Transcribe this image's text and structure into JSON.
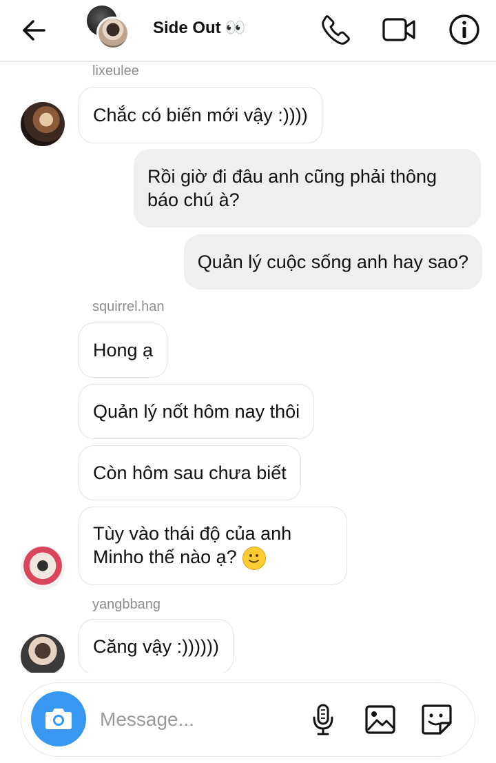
{
  "header": {
    "title": "Side Out",
    "title_emoji": "👀"
  },
  "messages": {
    "sender_1": "lixeulee",
    "m1": "Chắc có biến mới vậy :))))",
    "m2": "Rồi giờ đi đâu anh cũng phải thông báo chú à?",
    "m3": "Quản lý cuộc sống anh hay sao?",
    "sender_2": "squirrel.han",
    "m4": "Hong ạ",
    "m5": "Quản lý nốt hôm nay thôi",
    "m6": "Còn hôm sau chưa biết",
    "m7": "Tùy vào thái độ của anh Minho thế nào ạ?",
    "sender_3": "yangbbang",
    "m8": "Căng vậy :))))))"
  },
  "composer": {
    "placeholder": "Message..."
  },
  "colors": {
    "accent": "#3897f0",
    "outgoing_bubble": "#efefef",
    "sender_name": "#8e8e8e"
  },
  "icons": [
    "back-arrow-icon",
    "phone-icon",
    "video-camera-icon",
    "info-icon",
    "camera-icon",
    "microphone-icon",
    "gallery-icon",
    "sticker-icon",
    "smiley-emoji-icon"
  ]
}
